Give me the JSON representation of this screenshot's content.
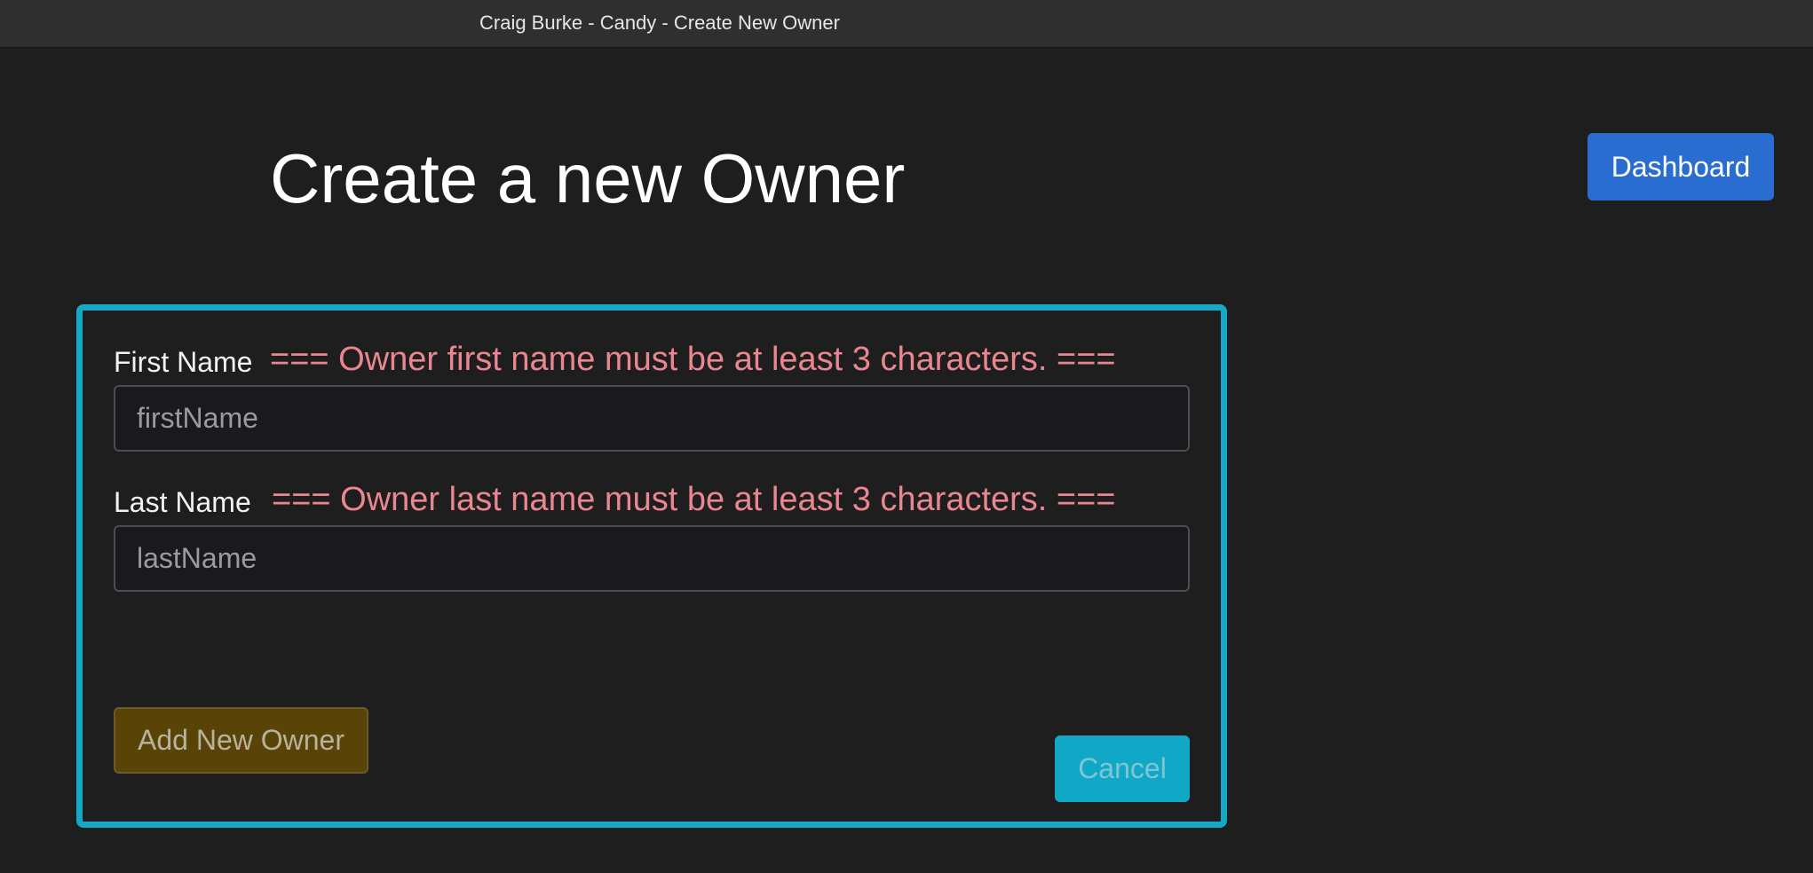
{
  "window": {
    "title": "Craig Burke - Candy - Create New Owner"
  },
  "header": {
    "page_title": "Create a new Owner",
    "dashboard_label": "Dashboard"
  },
  "form": {
    "first_name": {
      "label": "First Name",
      "error": "=== Owner first name must be at least 3 characters. ===",
      "placeholder": "firstName",
      "value": ""
    },
    "last_name": {
      "label": "Last Name",
      "error": "=== Owner last name must be at least 3 characters. ===",
      "placeholder": "lastName",
      "value": ""
    },
    "submit_label": "Add New Owner",
    "cancel_label": "Cancel"
  },
  "colors": {
    "accent_border": "#14a9c6",
    "primary_button": "#2a6dd1",
    "error_text": "#ea868f",
    "warning_button": "#5a4307",
    "info_button": "#11a8c7"
  }
}
